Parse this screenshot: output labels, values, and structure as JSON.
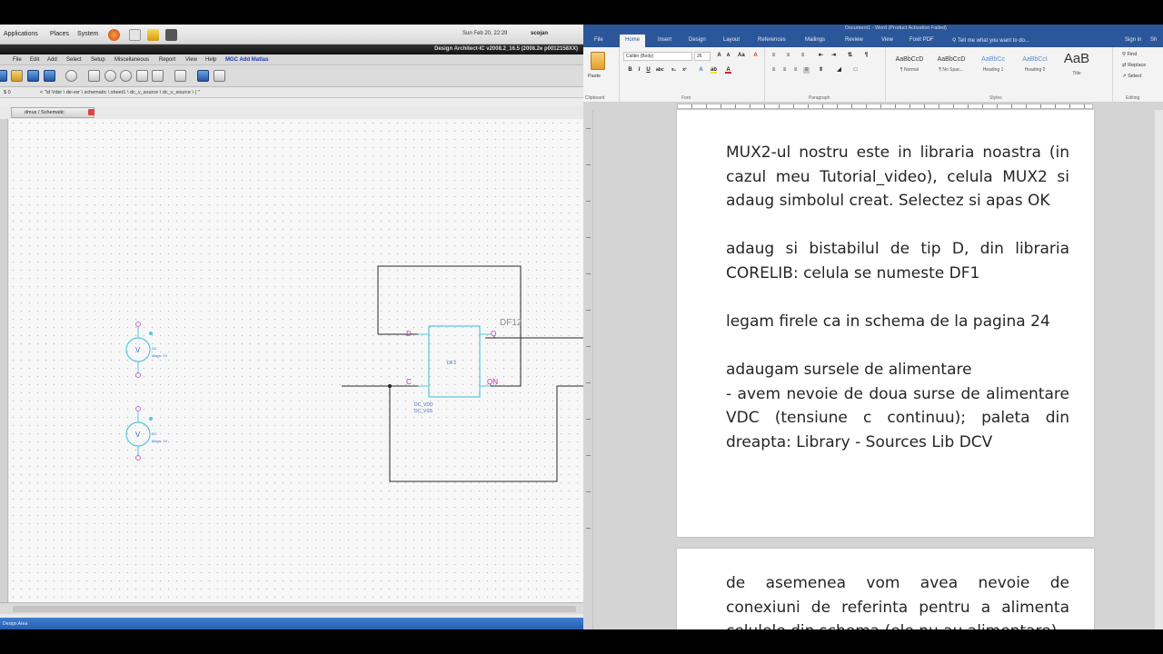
{
  "left": {
    "gnome": {
      "menus": [
        "Applications",
        "Places",
        "System"
      ],
      "clock": "Sun Feb 20, 22:29",
      "user": "scojan"
    },
    "app_title": "Design Architect-IC v2008.2_16.5   (2008.2e p0012158XX)",
    "menubar": [
      "File",
      "Edit",
      "Add",
      "Select",
      "Setup",
      "Miscellaneous",
      "Report",
      "View",
      "Help",
      "MGC Add Matlas"
    ],
    "path": [
      "$ 0",
      "< \"\\d Vdsr \\ de-vsr \\ schematic \\ sheet1 \\ dc_v_source \\ dc_v_source \\ ( \""
    ],
    "tab_label": "dmux / Schematic",
    "status": "Design Area",
    "schematic": {
      "component_label": "DF12",
      "cell_name": "DF1",
      "pins": {
        "d": "D",
        "q": "Q",
        "c": "C",
        "qn": "QN"
      },
      "properties": [
        "DC_VDD",
        "DC_VSS"
      ],
      "source_symbol": "V",
      "source_prop": "DC",
      "source_value": "Magn: 1V"
    }
  },
  "word": {
    "title": "Document1 - Word (Product Activation Failed)",
    "tabs": [
      "File",
      "Home",
      "Insert",
      "Design",
      "Layout",
      "References",
      "Mailings",
      "Review",
      "View",
      "Foxit PDF"
    ],
    "tell_me": "Tell me what you want to do...",
    "sign_in": "Sign in",
    "share": "Sh",
    "font_name": "Calibri (Body)",
    "font_size": "26",
    "groups": [
      "Clipboard",
      "Font",
      "Paragraph",
      "Styles",
      "Editing"
    ],
    "paste_label": "Paste",
    "styles": [
      {
        "sample": "AaBbCcD",
        "name": "¶ Normal"
      },
      {
        "sample": "AaBbCcD",
        "name": "¶ No Spac..."
      },
      {
        "sample": "AaBbCc",
        "name": "Heading 1"
      },
      {
        "sample": "AaBbCcI",
        "name": "Heading 2"
      },
      {
        "sample": "AaB",
        "name": "Title"
      }
    ],
    "editing": [
      "Find",
      "Replace",
      "Select"
    ],
    "page1": [
      [
        "MUX2-ul nostru este in libraria noastra (in",
        "cazul meu Tutorial_video), celula MUX2 si",
        "adaug simbolul creat. Selectez si apas OK"
      ],
      [
        "adaug si bistabilul de tip D, din libraria",
        "CORELIB: celula se numeste DF1"
      ],
      [
        "legam firele ca in schema de la pagina 24"
      ],
      [
        "adaugam sursele de alimentare",
        "- avem nevoie de doua surse de alimentare",
        "VDC (tensiune c continuu); paleta din",
        "dreapta: Library - Sources Lib DCV"
      ]
    ],
    "page2": [
      "de asemenea vom avea nevoie de",
      "conexiuni de referinta pentru a alimenta",
      "celulele din schema (ele nu au alimentare)"
    ]
  }
}
